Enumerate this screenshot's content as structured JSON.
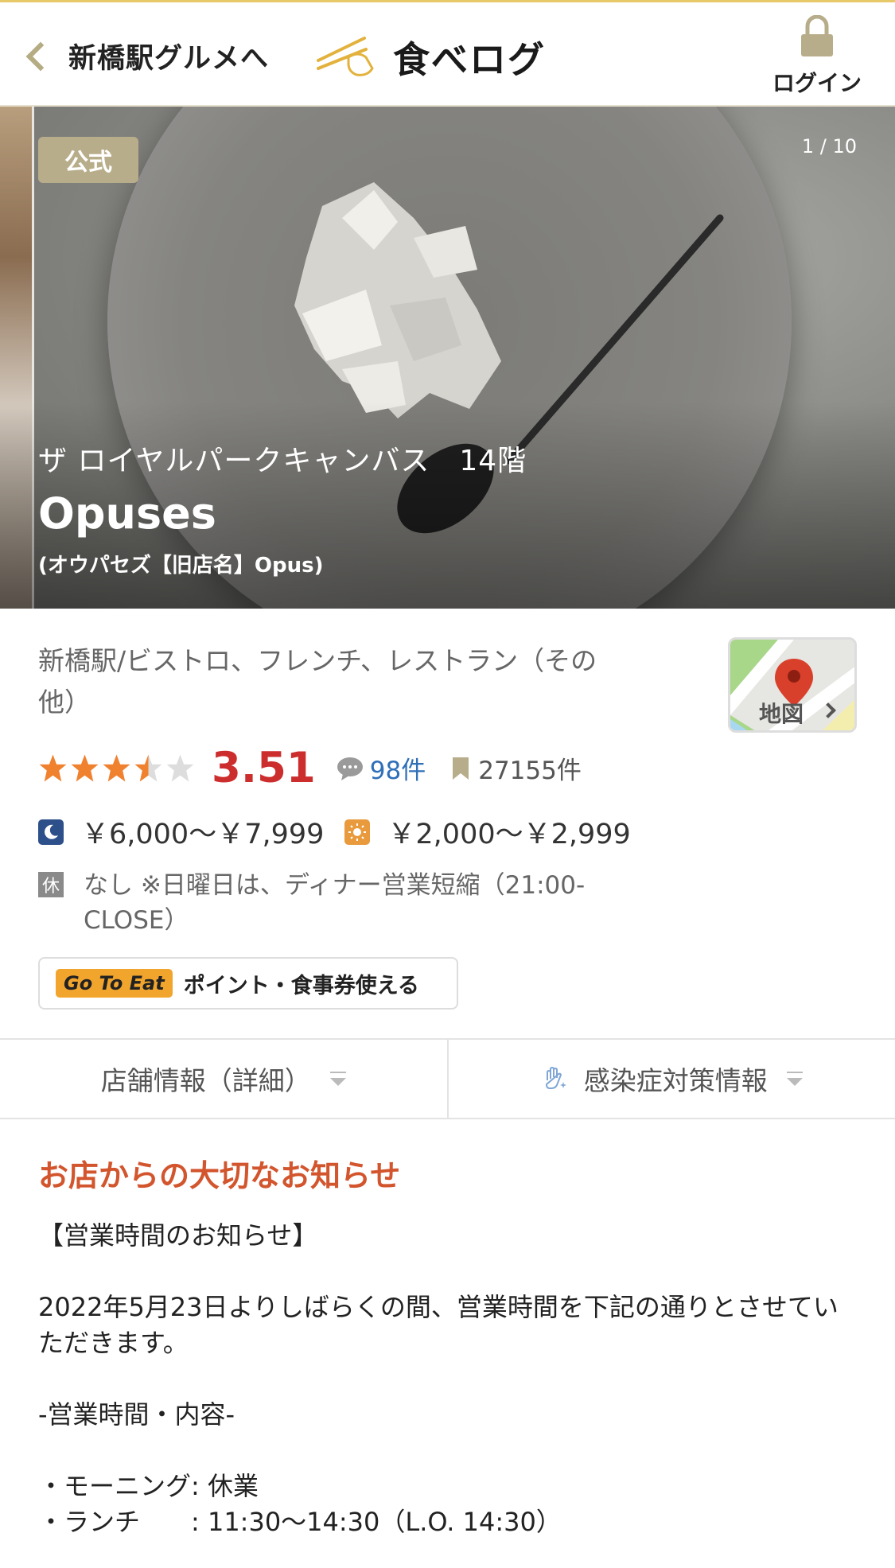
{
  "header": {
    "back_label": "新橋駅グルメへ",
    "logo_text": "食べログ",
    "login_label": "ログイン"
  },
  "hero": {
    "badge": "公式",
    "counter": "1 / 10",
    "building": "ザ ロイヤルパークキャンバス　14階",
    "name": "Opuses",
    "name_alt": "(オウパセズ【旧店名】Opus)"
  },
  "info": {
    "genre": "新橋駅/ビストロ、フレンチ、レストラン（その他）",
    "map_label": "地図",
    "rating": {
      "stars_value": 3.51,
      "score": "3.51",
      "reviews": "98件",
      "bookmarks": "27155件"
    },
    "dinner_price": "￥6,000～￥7,999",
    "lunch_price": "￥2,000～￥2,999",
    "holiday_icon": "休",
    "holiday_text": "なし ※日曜日は、ディナー営業短縮（21:00-CLOSE）",
    "goto_tag": "Go To Eat",
    "goto_text": "ポイント・食事券使える"
  },
  "tabs": [
    {
      "label": "店舗情報（詳細）"
    },
    {
      "label": "感染症対策情報"
    }
  ],
  "notice": {
    "title": "お店からの大切なお知らせ",
    "lines": [
      "【営業時間のお知らせ】",
      "",
      "2022年5月23日よりしばらくの間、営業時間を下記の通りとさせていただきます。",
      "",
      "-営業時間・内容-",
      "",
      "・モーニング: 休業",
      "・ランチ　　: 11:30～14:30（L.O. 14:30）"
    ]
  },
  "colors": {
    "accent_gold": "#b8ad8a",
    "score_red": "#cc2d2d",
    "star_orange": "#f0812e",
    "notice_title": "#d2552d",
    "link_blue": "#2f6fb8"
  },
  "icons": [
    "chevron-left-icon",
    "chopsticks-logo-icon",
    "lock-icon",
    "map-pin-icon",
    "comment-icon",
    "bookmark-icon",
    "moon-icon",
    "sun-icon",
    "hand-sparkle-icon"
  ]
}
